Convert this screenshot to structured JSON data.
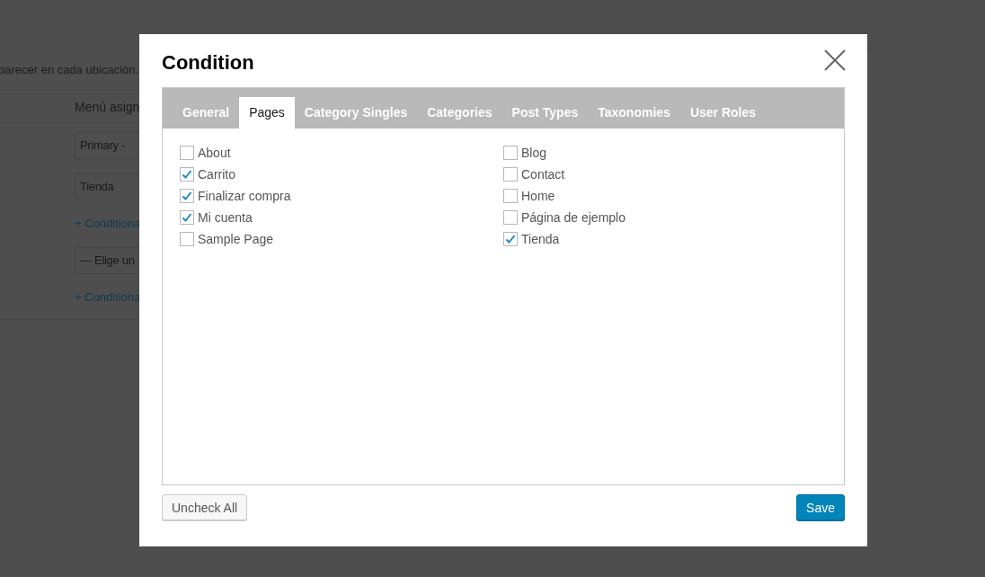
{
  "background_page": {
    "description": "parecer en cada ubicación.",
    "column_header": "Menú asign",
    "rows": [
      {
        "kind": "select",
        "text": "Primary -"
      },
      {
        "kind": "select",
        "text": "Tienda"
      },
      {
        "kind": "link",
        "text": "+ Conditiona"
      },
      {
        "kind": "select",
        "text": "— Elige un"
      },
      {
        "kind": "link",
        "text": "+ Conditiona"
      }
    ]
  },
  "dialog": {
    "title": "Condition",
    "tabs": [
      {
        "label": "General",
        "selected": false
      },
      {
        "label": "Pages",
        "selected": true
      },
      {
        "label": "Category Singles",
        "selected": false
      },
      {
        "label": "Categories",
        "selected": false
      },
      {
        "label": "Post Types",
        "selected": false
      },
      {
        "label": "Taxonomies",
        "selected": false
      },
      {
        "label": "User Roles",
        "selected": false
      }
    ],
    "page_columns": [
      {
        "items": [
          {
            "label": "About",
            "checked": false
          },
          {
            "label": "Carrito",
            "checked": true
          },
          {
            "label": "Finalizar compra",
            "checked": true
          },
          {
            "label": "Mi cuenta",
            "checked": true
          },
          {
            "label": "Sample Page",
            "checked": false
          }
        ]
      },
      {
        "items": [
          {
            "label": "Blog",
            "checked": false
          },
          {
            "label": "Contact",
            "checked": false
          },
          {
            "label": "Home",
            "checked": false
          },
          {
            "label": "Página de ejemplo",
            "checked": false
          },
          {
            "label": "Tienda",
            "checked": true
          }
        ]
      }
    ],
    "buttons": [
      {
        "kind": "secondary",
        "label": "Uncheck All"
      },
      {
        "kind": "primary",
        "label": "Save"
      }
    ]
  }
}
